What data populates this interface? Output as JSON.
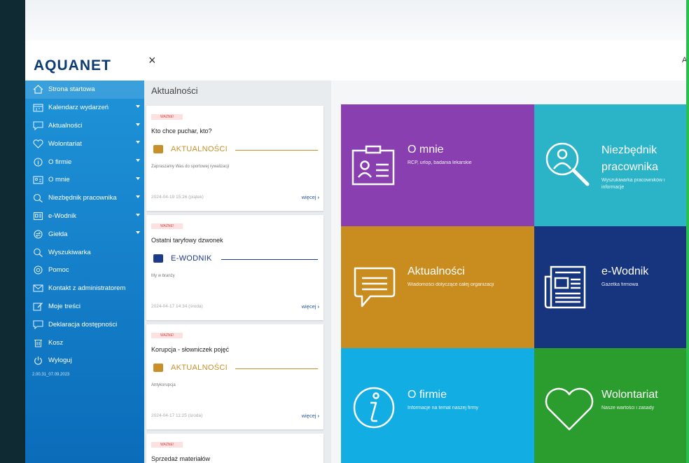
{
  "brand": {
    "logo": "AQUANET"
  },
  "header": {
    "close": "×",
    "right_letter": "A"
  },
  "sidebar": {
    "items": [
      {
        "label": "Strona startowa",
        "icon": "home-icon",
        "has_sub": false
      },
      {
        "label": "Kalendarz wydarzeń",
        "icon": "calendar-icon",
        "has_sub": true
      },
      {
        "label": "Aktualności",
        "icon": "chat-icon",
        "has_sub": true
      },
      {
        "label": "Wolontariat",
        "icon": "heart-icon",
        "has_sub": true
      },
      {
        "label": "O firmie",
        "icon": "info-icon",
        "has_sub": true
      },
      {
        "label": "O mnie",
        "icon": "id-card-icon",
        "has_sub": true
      },
      {
        "label": "Niezbędnik pracownika",
        "icon": "person-search-icon",
        "has_sub": true
      },
      {
        "label": "e-Wodnik",
        "icon": "newspaper-icon",
        "has_sub": true
      },
      {
        "label": "Giełda",
        "icon": "exchange-icon",
        "has_sub": true
      },
      {
        "label": "Wyszukiwarka",
        "icon": "search-icon",
        "has_sub": false
      },
      {
        "label": "Pomoc",
        "icon": "lifebuoy-icon",
        "has_sub": false
      },
      {
        "label": "Kontakt z administratorem",
        "icon": "mail-icon",
        "has_sub": false
      },
      {
        "label": "Moje treści",
        "icon": "edit-icon",
        "has_sub": false
      },
      {
        "label": "Deklaracja dostępności",
        "icon": "chat-icon",
        "has_sub": false
      },
      {
        "label": "Kosz",
        "icon": "trash-icon",
        "has_sub": false
      },
      {
        "label": "Wyloguj",
        "icon": "power-icon",
        "has_sub": false
      }
    ],
    "version": "2.00.31_07.09.2023"
  },
  "news": {
    "header": "Aktualności",
    "cards": [
      {
        "badge": "WAŻNE!",
        "title": "Kto chce puchar, kto?",
        "category": "AKTUALNOŚCI",
        "category_color": "#c8902a",
        "desc": "Zapraszamy Was do sportowej rywalizacji",
        "date": "2024-04-19 15:26 (piątek)",
        "more": "więcej"
      },
      {
        "badge": "WAŻNE!",
        "title": "Ostatni taryfowy dzwonek",
        "category": "E-WODNIK",
        "category_color": "#1e3a8a",
        "desc": "My w branży",
        "date": "2024-04-17 14:34 (środa)",
        "more": "więcej"
      },
      {
        "badge": "WAŻNE!",
        "title": "Korupcja - słowniczek pojęć",
        "category": "AKTUALNOŚCI",
        "category_color": "#c8902a",
        "desc": "Antykorupcja",
        "date": "2024-04-17 11:25 (środa)",
        "more": "więcej"
      },
      {
        "badge": "WAŻNE!",
        "title": "Sprzedaż materiałów",
        "category": "",
        "category_color": "#c8902a",
        "desc": "",
        "date": "",
        "more": ""
      }
    ]
  },
  "tiles": [
    {
      "title": "O mnie",
      "subtitle": "RCP, urlop, badania lekarskie",
      "color": "#8a3fb0",
      "icon": "id-card-icon"
    },
    {
      "title": "Niezbędnik pracownika",
      "title_line1": "Niezbędnik",
      "title_line2": "pracownika",
      "subtitle": "Wyszukiwarka pracowników i informacje",
      "subtitle_line1": "Wyszukiwarka pracowników i",
      "subtitle_line2": "informacje",
      "color": "#2bb3c7",
      "icon": "person-search-icon"
    },
    {
      "title": "Aktualności",
      "subtitle": "Wiadomości dotyczące całej organizacji",
      "color": "#c98c1e",
      "icon": "chat-icon"
    },
    {
      "title": "e-Wodnik",
      "subtitle": "Gazetka firmowa",
      "color": "#16357e",
      "icon": "newspaper-icon"
    },
    {
      "title": "O firmie",
      "subtitle": "Informacje na temat naszej firmy",
      "color": "#12aee3",
      "icon": "info-icon"
    },
    {
      "title": "Wolontariat",
      "subtitle": "Nasze wartości i zasady",
      "color": "#2a9d2e",
      "icon": "heart-icon"
    }
  ]
}
